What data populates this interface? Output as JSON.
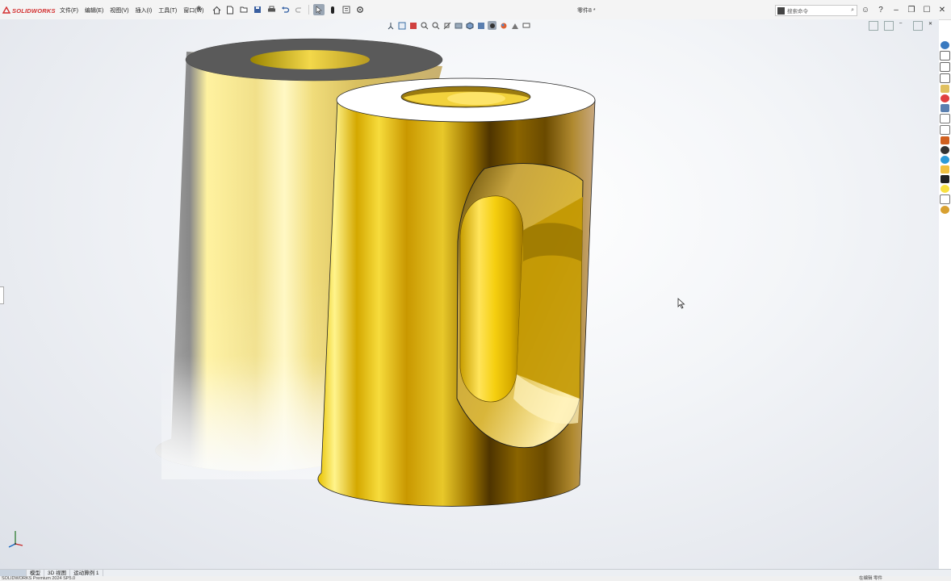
{
  "app": {
    "logo_text": "SOLIDWORKS",
    "document_title": "零件8 *",
    "accent_color": "#d32f2f"
  },
  "menu": {
    "items": [
      "文件(F)",
      "编辑(E)",
      "视图(V)",
      "插入(I)",
      "工具(T)",
      "窗口(W)"
    ]
  },
  "search": {
    "placeholder": "搜索命令"
  },
  "window_controls": [
    "minimize",
    "restore",
    "maximize",
    "close"
  ],
  "bottom_tabs": {
    "items": [
      "模型",
      "3D 视图",
      "运动算例 1"
    ]
  },
  "status_bar": {
    "left_text": "SOLIDWORKS Premium 2024 SP5.0",
    "right_text": "在编辑 零件"
  },
  "model": {
    "name": "brass-tube-with-slot",
    "material_color": "#e3b400",
    "icons": [
      "home-icon",
      "new-document-icon",
      "open-icon",
      "save-icon",
      "print-icon",
      "undo-icon",
      "redo-icon",
      "select-icon",
      "rebuild-icon",
      "file-properties-icon",
      "options-icon"
    ]
  }
}
